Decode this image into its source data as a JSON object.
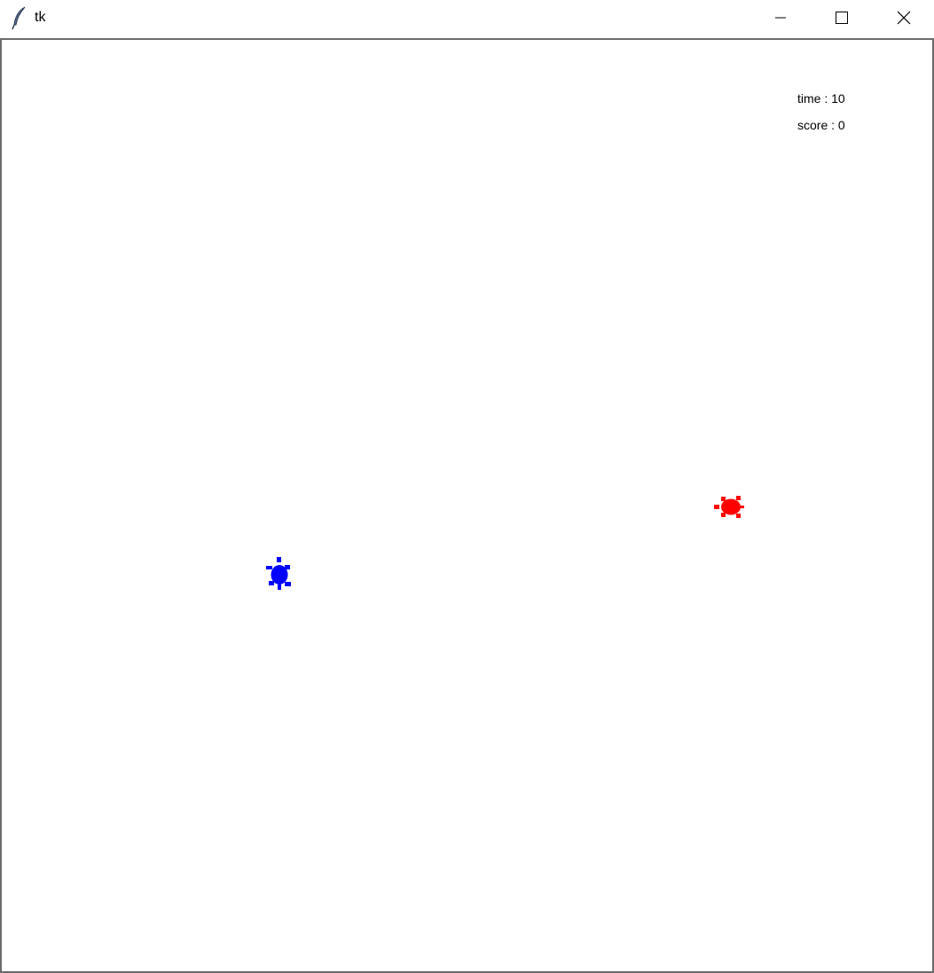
{
  "window": {
    "title": "tk",
    "icons": {
      "app": "feather-icon",
      "minimize": "minimize-icon",
      "maximize": "maximize-icon",
      "close": "close-icon"
    }
  },
  "hud": {
    "time_label": "time : 10",
    "score_label": "score : 0"
  },
  "sprites": {
    "player_color": "#0000ff",
    "enemy_color": "#ff0000",
    "shape": "turtle"
  }
}
